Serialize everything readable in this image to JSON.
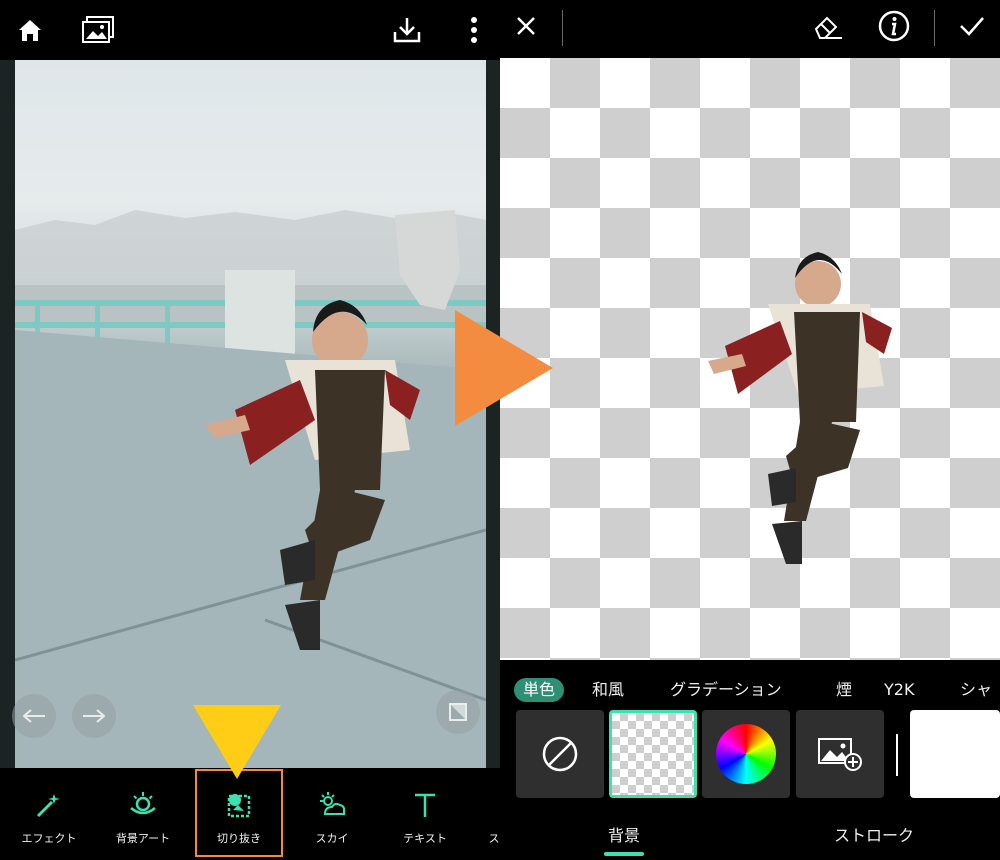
{
  "editor": {
    "tools": [
      {
        "label": "エフェクト",
        "icon": "magic-wand-icon"
      },
      {
        "label": "背景アート",
        "icon": "background-art-icon"
      },
      {
        "label": "切り抜き",
        "icon": "cutout-icon",
        "active": true
      },
      {
        "label": "スカイ",
        "icon": "sky-icon"
      },
      {
        "label": "テキスト",
        "icon": "text-icon"
      },
      {
        "label": "ス",
        "icon": ""
      }
    ],
    "top_icons": [
      "home-icon",
      "gallery-icon",
      "download-icon",
      "more-vertical-icon"
    ]
  },
  "cutout": {
    "top_icons": [
      "close-icon",
      "eraser-icon",
      "info-icon",
      "check-icon"
    ],
    "bg_tabs": [
      "単色",
      "和風",
      "グラデーション",
      "煙",
      "Y2K",
      "シャ"
    ],
    "selected_bg_tab": "単色",
    "swatches": [
      "none-icon",
      "transparent",
      "color-wheel",
      "add-image-icon",
      "white"
    ],
    "bottom_tabs": [
      "背景",
      "ストローク"
    ],
    "selected_bottom_tab": "背景"
  },
  "colors": {
    "accent": "#3de0b0",
    "active_tool_border": "#f58a3c",
    "arrow": "#f48c3f",
    "pointer": "#ffcc16"
  }
}
